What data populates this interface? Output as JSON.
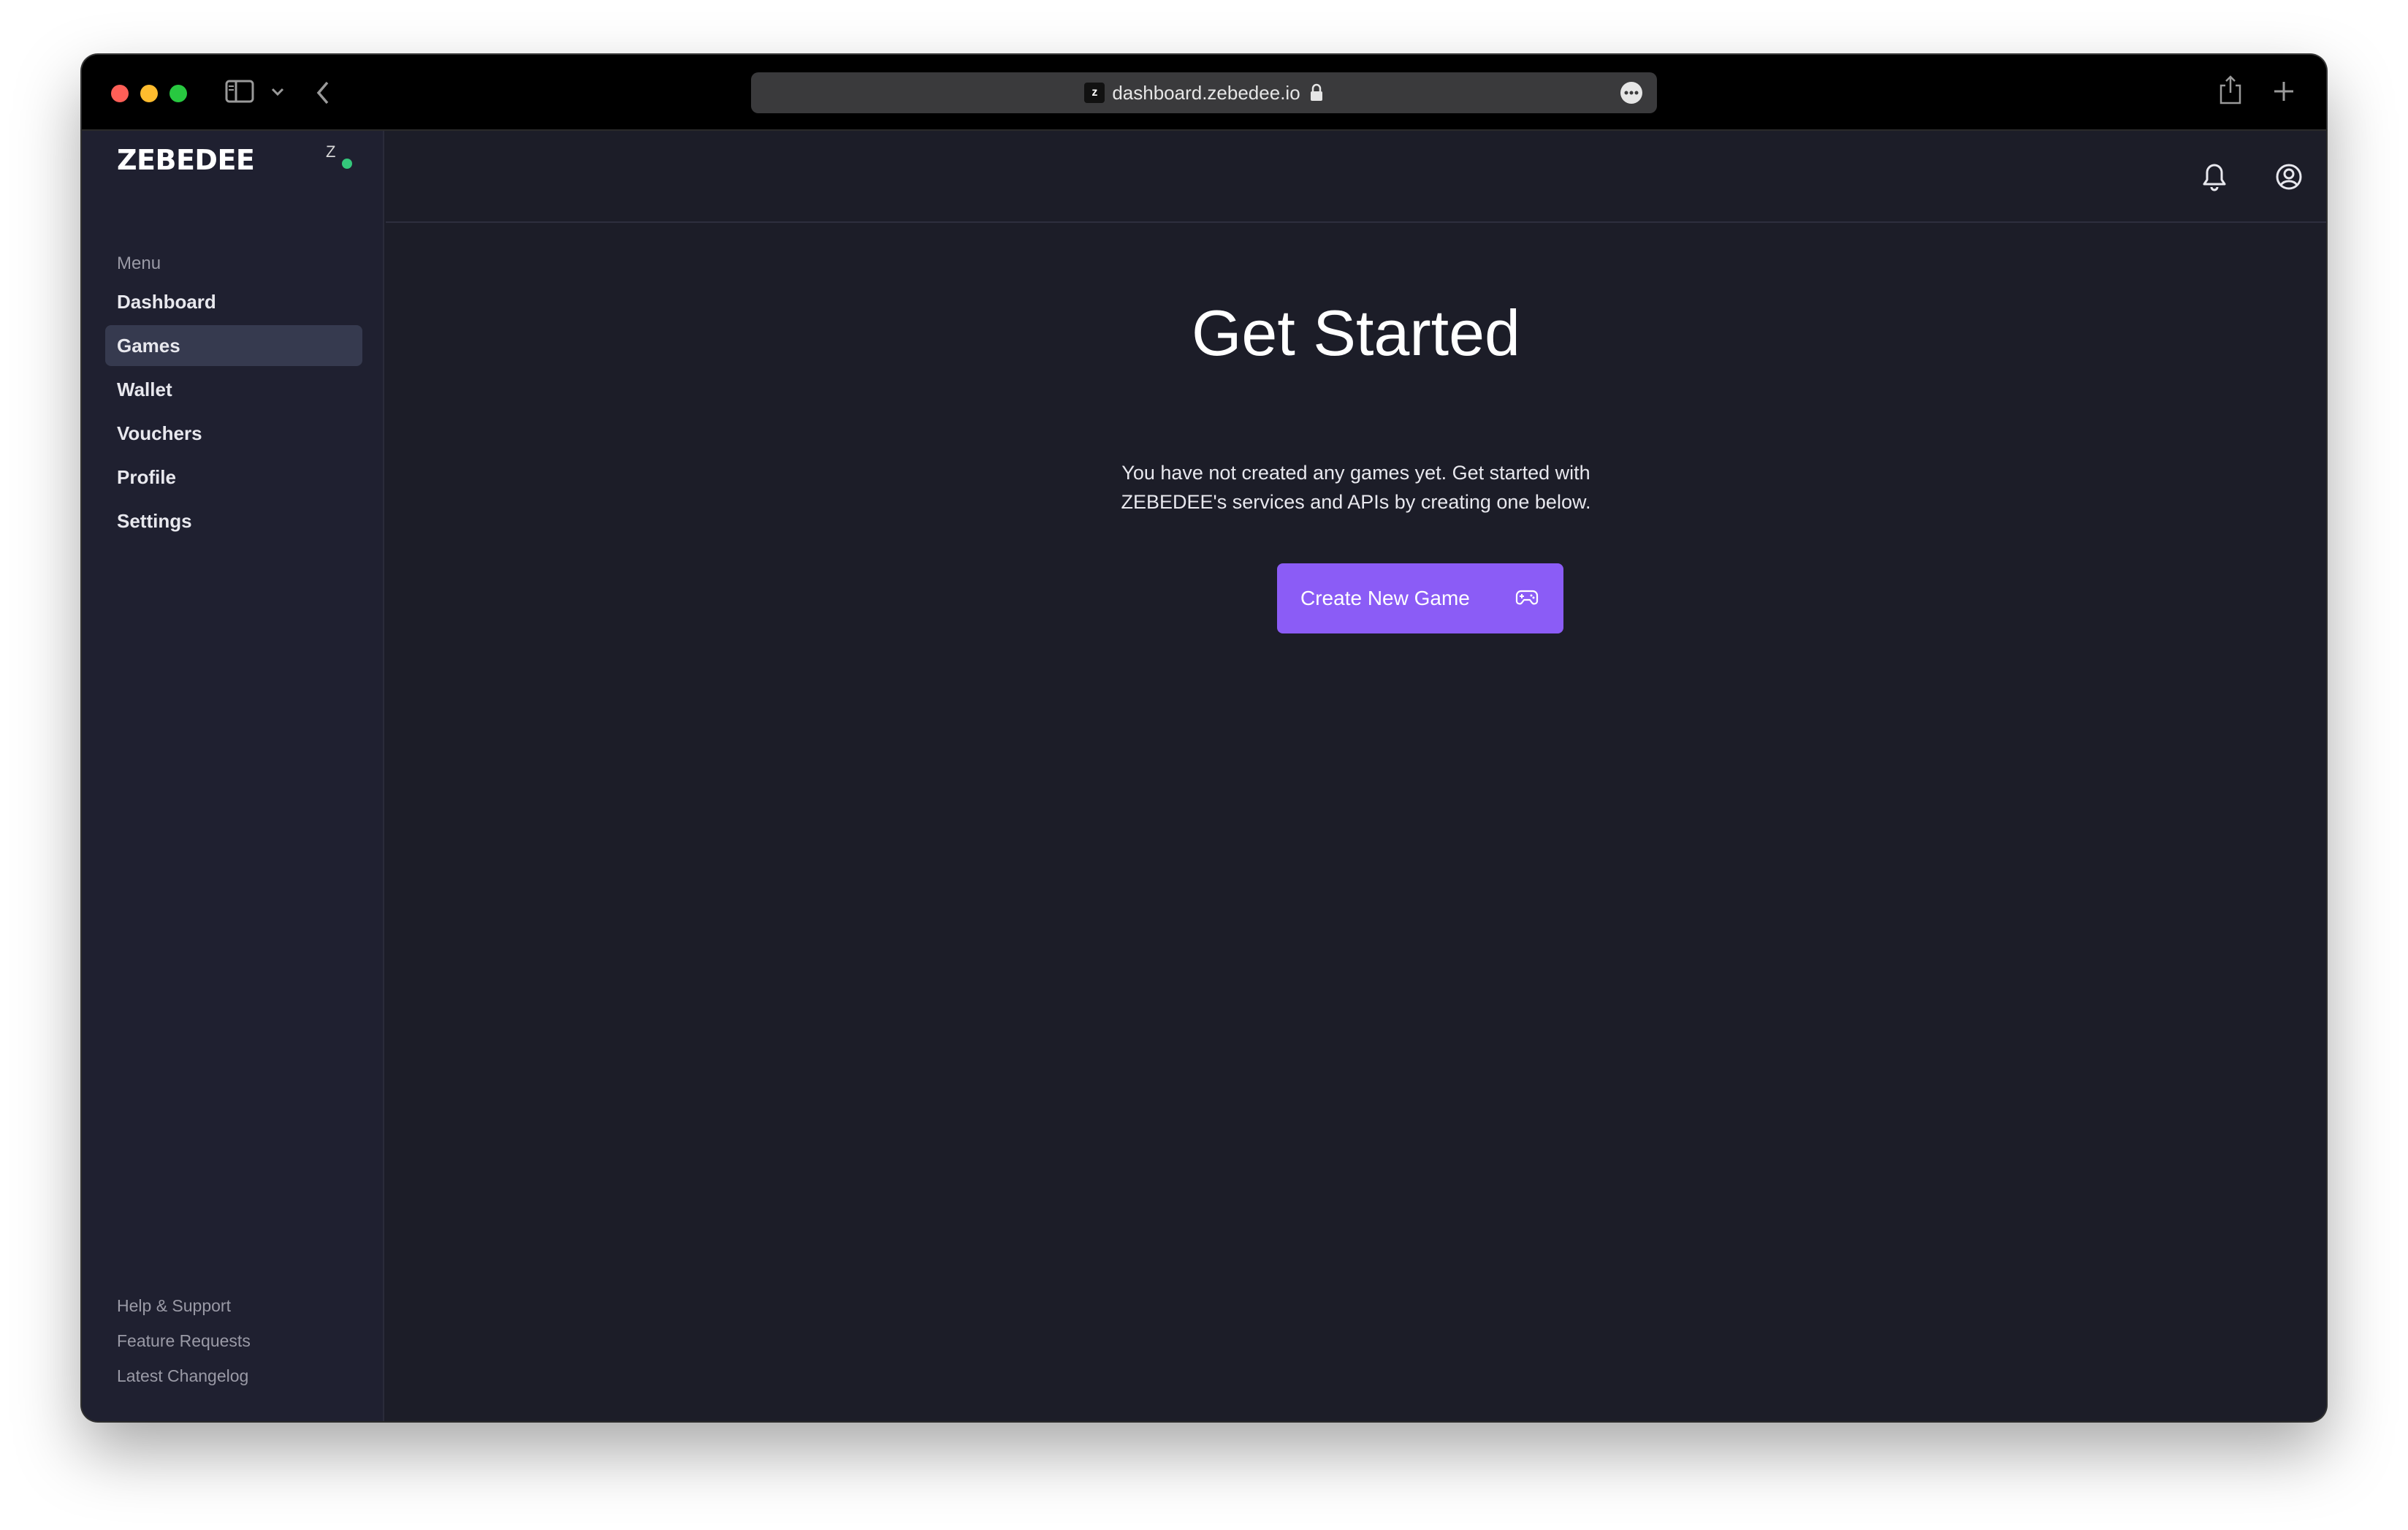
{
  "browser": {
    "url": "dashboard.zebedee.io",
    "favicon_letter": "z"
  },
  "sidebar": {
    "brand": "ZEBEDEE",
    "avatar_letter": "Z",
    "menu_label": "Menu",
    "items": [
      {
        "label": "Dashboard",
        "active": false
      },
      {
        "label": "Games",
        "active": true
      },
      {
        "label": "Wallet",
        "active": false
      },
      {
        "label": "Vouchers",
        "active": false
      },
      {
        "label": "Profile",
        "active": false
      },
      {
        "label": "Settings",
        "active": false
      }
    ],
    "footer": [
      {
        "label": "Help & Support"
      },
      {
        "label": "Feature Requests"
      },
      {
        "label": "Latest Changelog"
      }
    ]
  },
  "main": {
    "title": "Get Started",
    "description": "You have not created any games yet. Get started with ZEBEDEE's services and APIs by creating one below.",
    "create_button_label": "Create New Game"
  },
  "colors": {
    "accent": "#8b5cf6",
    "background": "#1c1d28",
    "sidebar": "#1f2030",
    "active_item": "#363a4f",
    "status_online": "#34c77b"
  },
  "icons": [
    "sidebar-toggle-icon",
    "chevron-down-icon",
    "back-arrow-icon",
    "lock-icon",
    "more-icon",
    "share-icon",
    "plus-icon",
    "bell-icon",
    "user-circle-icon",
    "gamepad-icon"
  ]
}
